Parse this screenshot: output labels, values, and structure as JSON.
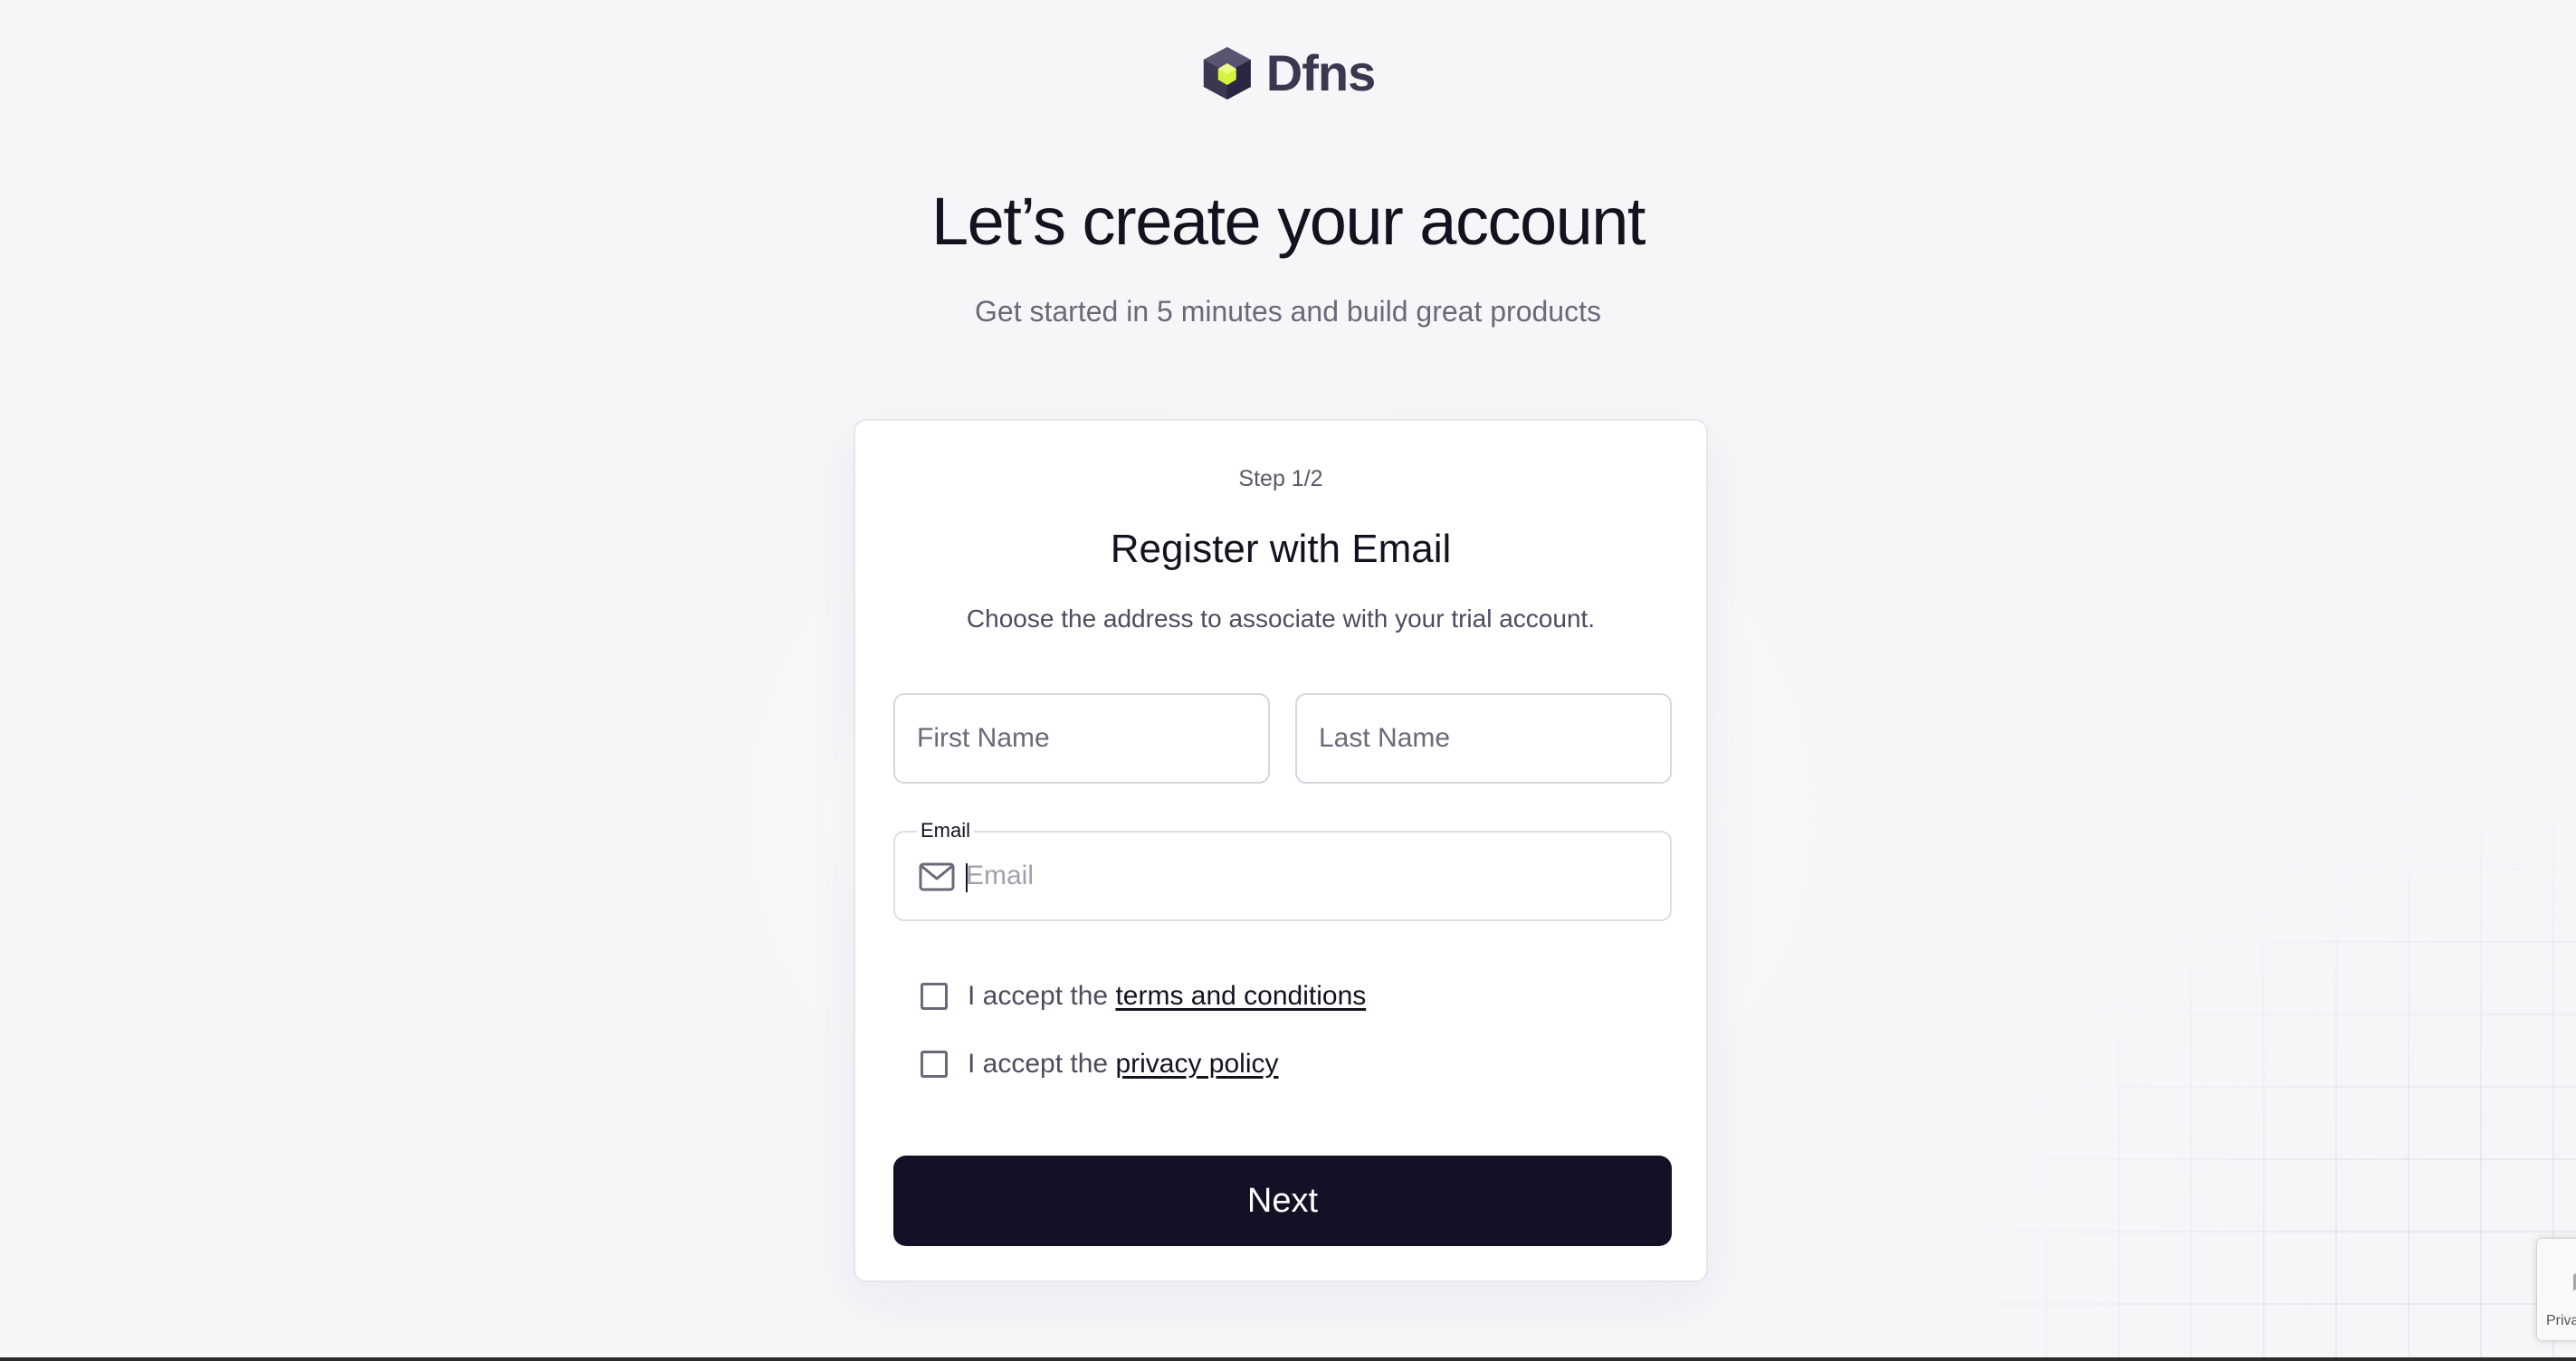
{
  "brand": {
    "name": "Dfns",
    "mark_color": "#3c3751",
    "mark_accent": "#d6f23c"
  },
  "hero": {
    "title": "Let’s create your account",
    "subtitle": "Get started in 5 minutes and build great products"
  },
  "card": {
    "step": "Step 1/2",
    "title": "Register with Email",
    "description": "Choose the address to associate with your trial account."
  },
  "form": {
    "first_name_placeholder": "First Name",
    "last_name_placeholder": "Last Name",
    "email_label": "Email",
    "email_placeholder": "Email",
    "terms": {
      "prefix": "I accept the ",
      "link": "terms and conditions",
      "checked": false
    },
    "privacy": {
      "prefix": "I accept the ",
      "link": "privacy policy",
      "checked": false
    },
    "next_label": "Next"
  },
  "recaptcha": {
    "text": "Privacy"
  },
  "colors": {
    "primary_button": "#161026",
    "background": "#f6f6f9"
  }
}
